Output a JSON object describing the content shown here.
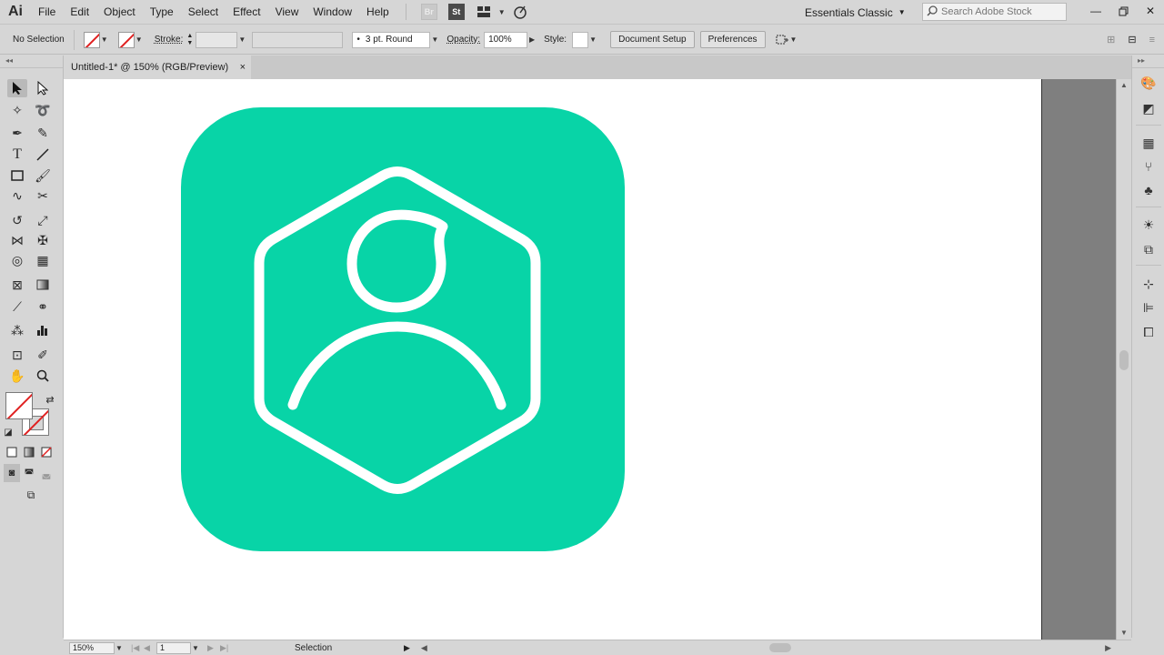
{
  "app": {
    "logo": "Ai",
    "menu": [
      "File",
      "Edit",
      "Object",
      "Type",
      "Select",
      "Effect",
      "View",
      "Window",
      "Help"
    ],
    "bridge_icon_label": "Br",
    "stock_icon_label": "St",
    "workspace": "Essentials Classic",
    "search_placeholder": "Search Adobe Stock"
  },
  "control_bar": {
    "selection_status": "No Selection",
    "stroke_label": "Stroke:",
    "brush_value": "3 pt. Round",
    "opacity_label": "Opacity:",
    "opacity_value": "100%",
    "style_label": "Style:",
    "document_setup": "Document Setup",
    "preferences": "Preferences"
  },
  "document": {
    "tab_title": "Untitled-1* @ 150% (RGB/Preview)",
    "close_glyph": "×"
  },
  "artwork": {
    "background_color": "#08d4a7",
    "line_color": "#ffffff"
  },
  "status_bar": {
    "zoom": "150%",
    "artboard": "1",
    "tool": "Selection"
  },
  "colors": {
    "chrome": "#d6d6d6",
    "pasteboard": "#7f7f7f",
    "none_slash": "#e02020"
  }
}
